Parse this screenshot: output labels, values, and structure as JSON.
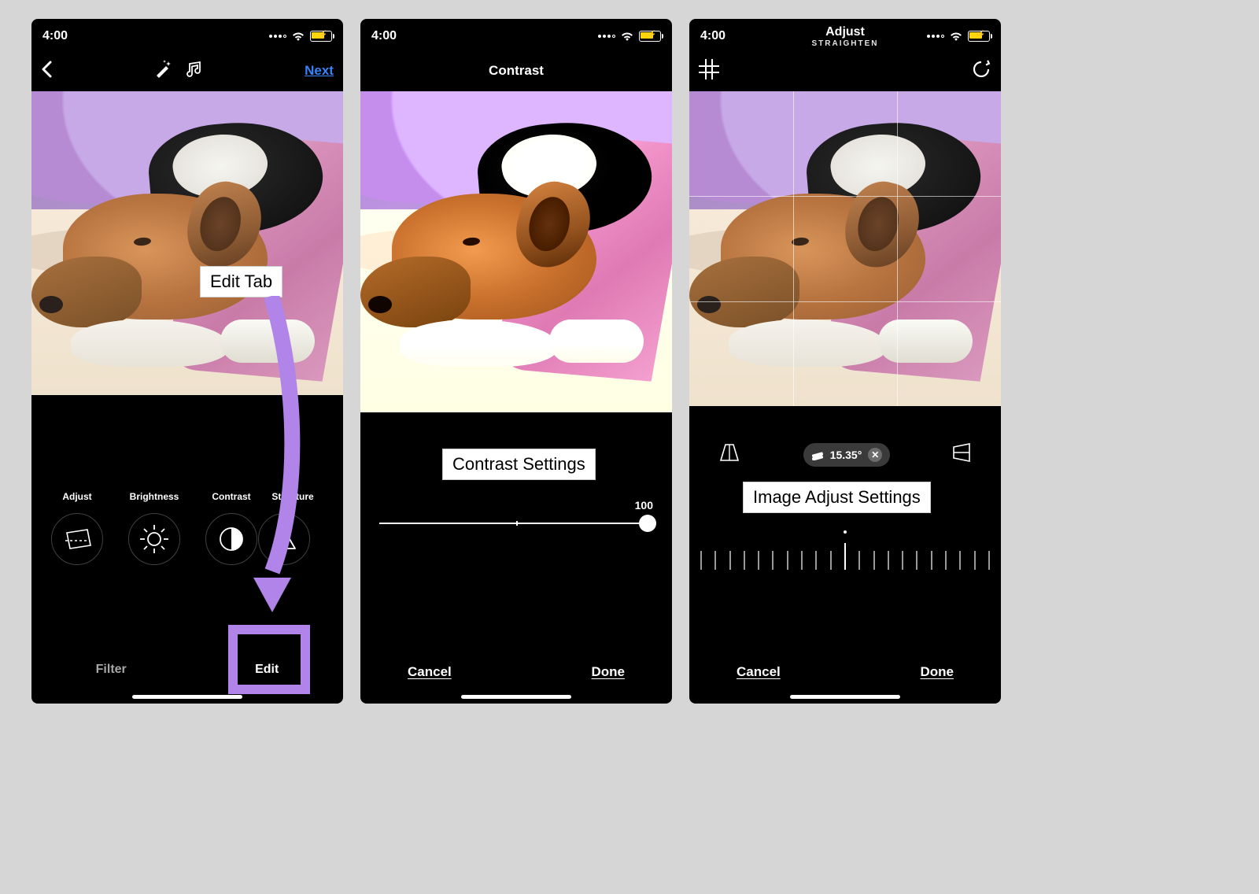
{
  "common": {
    "time": "4:00",
    "cancel": "Cancel",
    "done": "Done"
  },
  "screen1": {
    "next": "Next",
    "tabs": {
      "filter": "Filter",
      "edit": "Edit"
    },
    "tools": {
      "adjust": "Adjust",
      "brightness": "Brightness",
      "contrast": "Contrast",
      "structure": "Structure"
    },
    "annotation": "Edit Tab"
  },
  "screen2": {
    "title": "Contrast",
    "annotation": "Contrast Settings",
    "slider_value": "100"
  },
  "screen3": {
    "title": "Adjust",
    "subtitle": "STRAIGHTEN",
    "angle": "15.35°",
    "annotation": "Image Adjust Settings"
  },
  "colors": {
    "accent_purple": "#b084e8",
    "link_blue": "#3a82f7",
    "battery_yellow": "#ffd60a"
  }
}
